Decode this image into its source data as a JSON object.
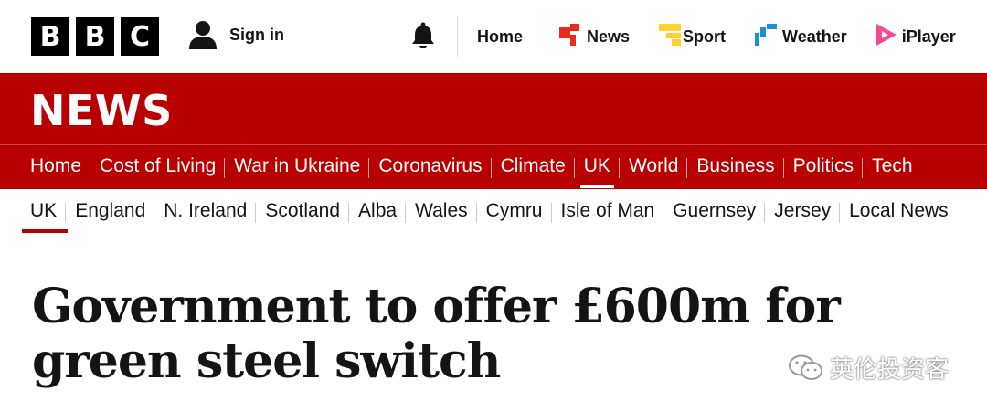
{
  "header": {
    "logo_letters": [
      "B",
      "B",
      "C"
    ],
    "sign_in": "Sign in",
    "nav": [
      {
        "label": "Home",
        "icon": "none"
      },
      {
        "label": "News",
        "icon": "news-icon",
        "color": "#e72e1c"
      },
      {
        "label": "Sport",
        "icon": "sport-icon",
        "color": "#ffd230"
      },
      {
        "label": "Weather",
        "icon": "weather-icon",
        "color": "#1d8fd4"
      },
      {
        "label": "iPlayer",
        "icon": "iplayer-icon",
        "color": "#f54997"
      }
    ]
  },
  "news_title": "NEWS",
  "primary_nav": [
    "Home",
    "Cost of Living",
    "War in Ukraine",
    "Coronavirus",
    "Climate",
    "UK",
    "World",
    "Business",
    "Politics",
    "Tech"
  ],
  "primary_active": "UK",
  "secondary_nav": [
    "UK",
    "England",
    "N. Ireland",
    "Scotland",
    "Alba",
    "Wales",
    "Cymru",
    "Isle of Man",
    "Guernsey",
    "Jersey",
    "Local News"
  ],
  "secondary_active": "UK",
  "headline": "Government to offer £600m for green steel switch",
  "watermark": "英伦投资客",
  "colors": {
    "brand_red": "#b80000"
  }
}
